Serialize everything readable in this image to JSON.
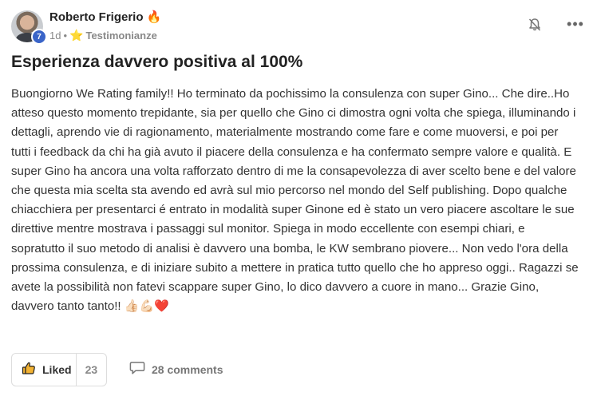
{
  "post": {
    "author": "Roberto Frigerio",
    "author_badge_emoji": "🔥",
    "level": "7",
    "time": "1d",
    "category_icon": "star-icon",
    "category": "Testimonianze",
    "title": "Esperienza davvero positiva al 100%",
    "body": "Buongiorno We Rating family!! Ho terminato da pochissimo la consulenza con super Gino... Che dire..Ho atteso questo momento trepidante, sia per quello che Gino ci dimostra ogni volta che spiega, illuminando i dettagli, aprendo vie di ragionamento, materialmente mostrando come fare e come muoversi, e poi per tutti i feedback da chi ha già avuto il piacere della consulenza e ha confermato sempre valore e qualità. E super Gino ha ancora una volta rafforzato dentro di me la consapevolezza di aver scelto bene e del valore che questa mia scelta sta avendo ed avrà sul mio percorso nel mondo del Self publishing. Dopo qualche chiacchiera per presentarci é entrato in modalità super Ginone ed è stato un vero piacere ascoltare le sue direttive mentre mostrava i passaggi sul monitor. Spiega in modo eccellente con esempi chiari, e sopratutto il suo metodo di analisi è davvero una bomba, le KW sembrano piovere... Non vedo l'ora della prossima consulenza, e di iniziare subito a mettere in pratica tutto quello che ho appreso oggi.. Ragazzi se avete la possibilità non fatevi scappare super Gino, lo dico davvero a cuore in mano... Grazie Gino, davvero tanto tanto!!",
    "body_emojis": [
      "👍🏻",
      "💪🏻",
      "❤️"
    ]
  },
  "actions": {
    "like_label": "Liked",
    "like_count": "23",
    "comments_label": "28 comments"
  },
  "colors": {
    "level_badge": "#3a64c8",
    "text": "#333333"
  }
}
